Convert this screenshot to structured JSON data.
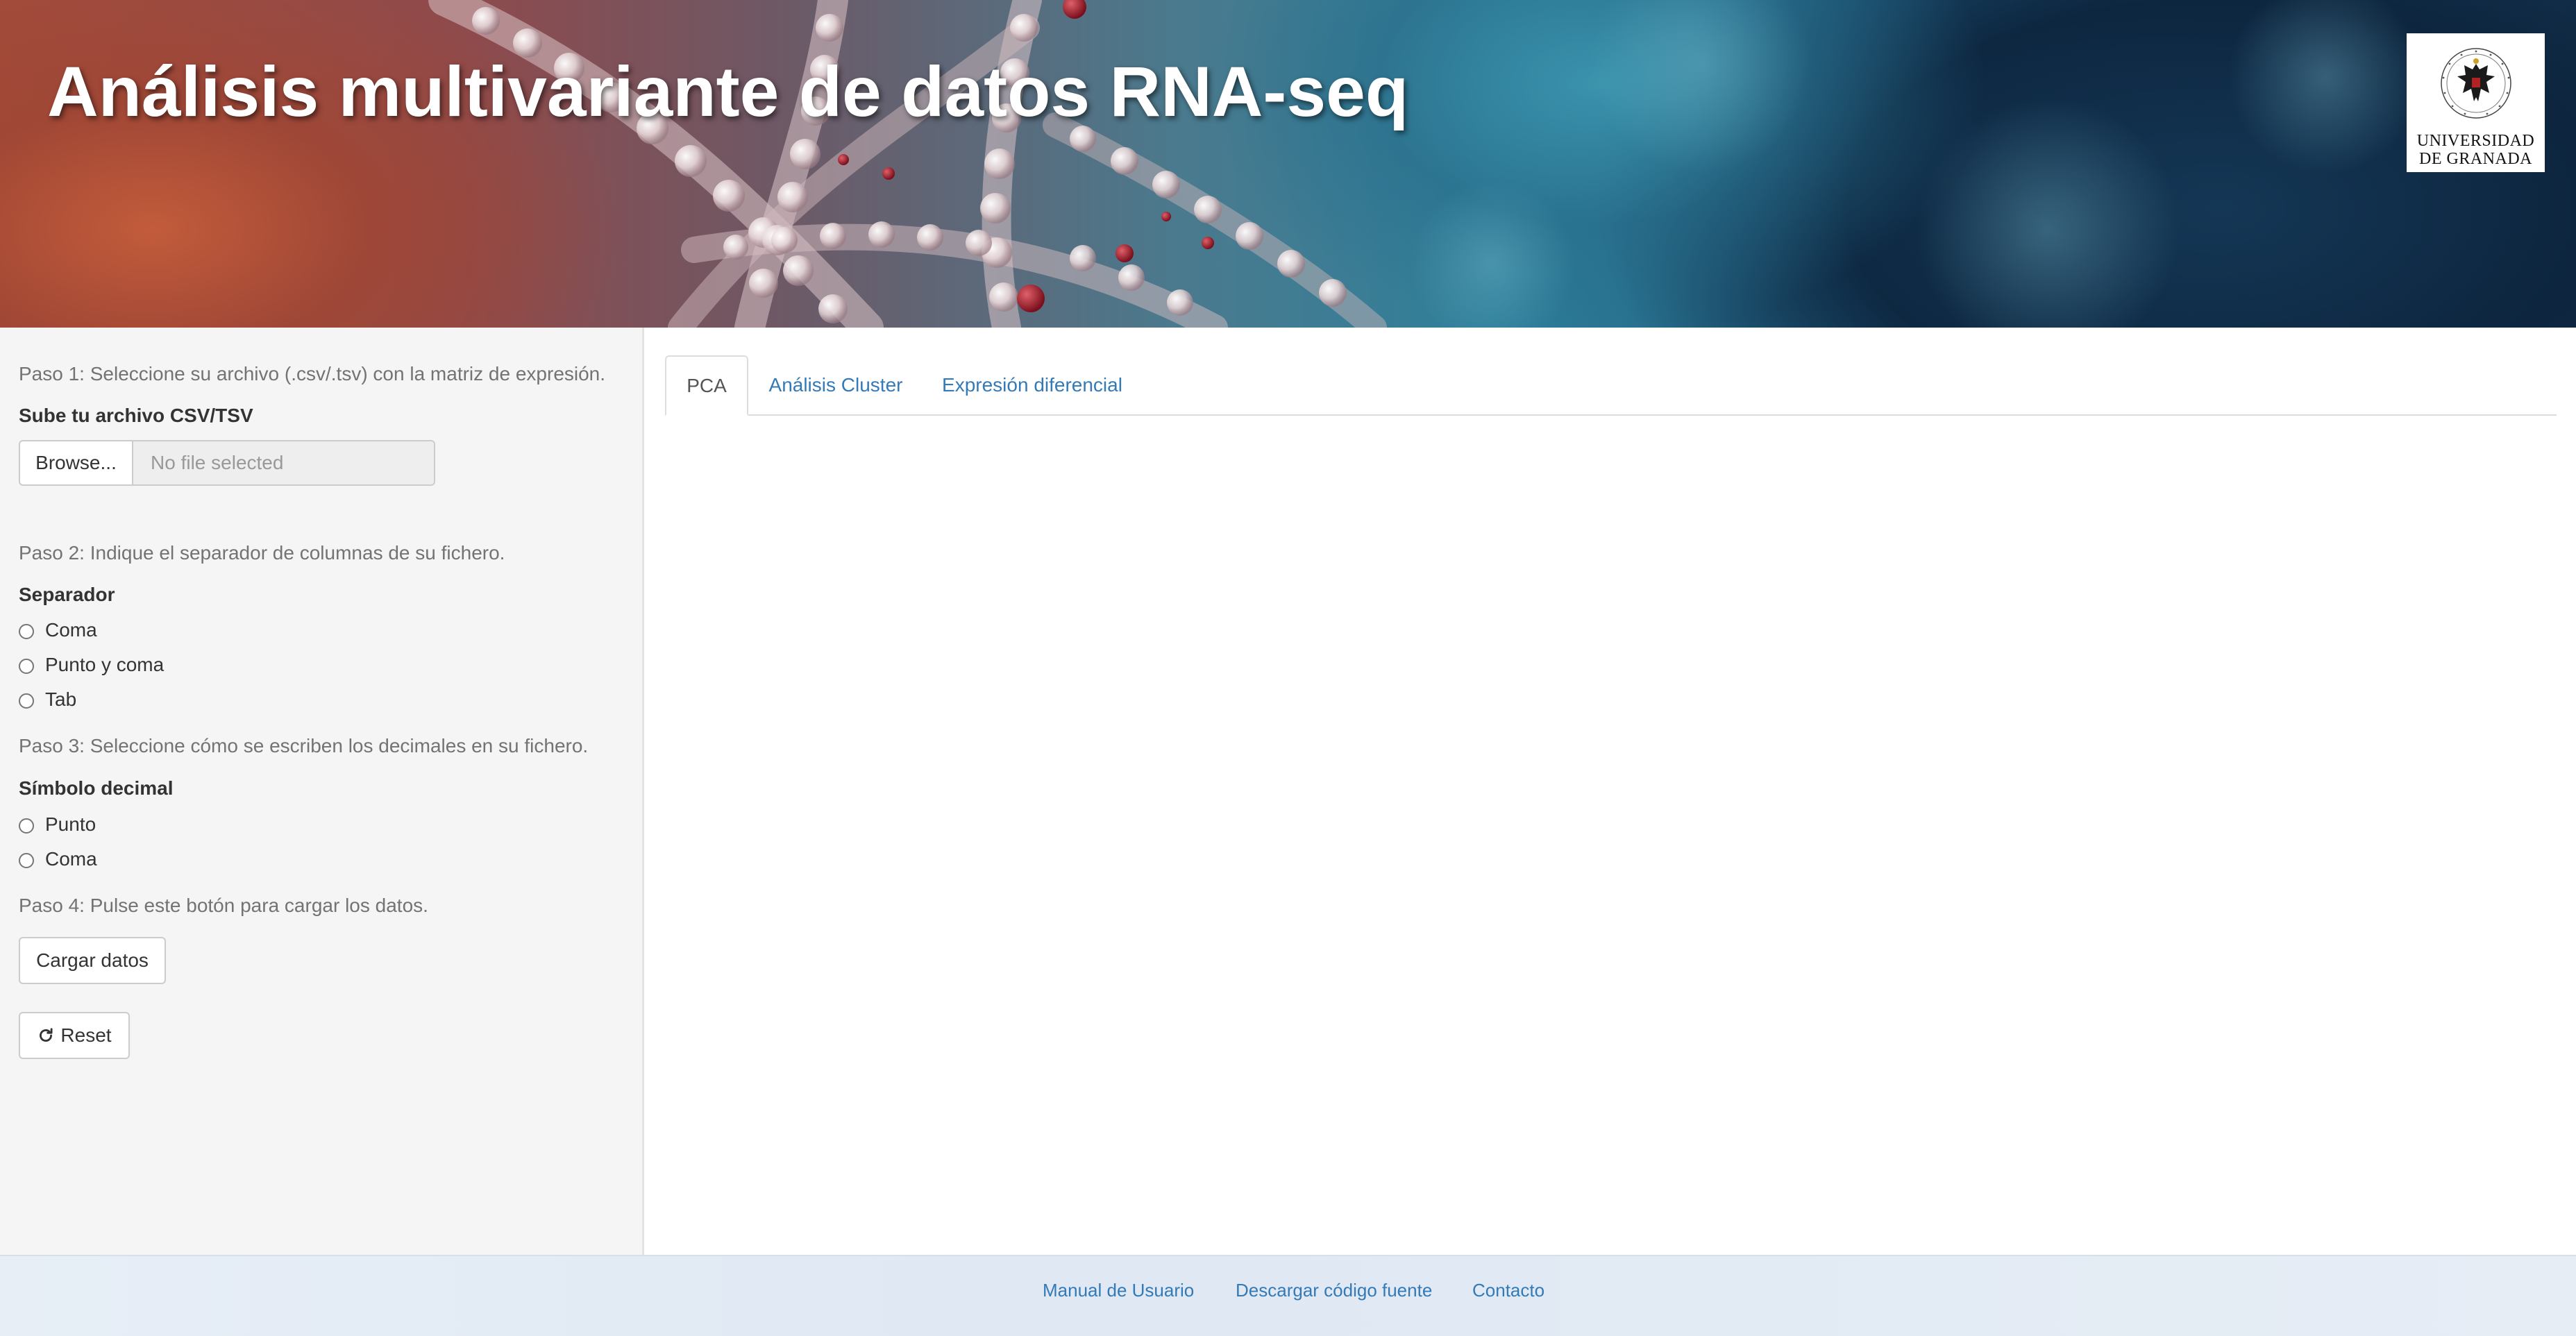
{
  "header": {
    "title": "Análisis multivariante de datos RNA-seq",
    "logo": {
      "icon": "university-crest-icon",
      "line1": "UNIVERSIDAD",
      "line2": "DE GRANADA"
    }
  },
  "sidebar": {
    "step1_text": "Paso 1: Seleccione su archivo (.csv/.tsv) con la matriz de expresión.",
    "file_label": "Sube tu archivo CSV/TSV",
    "browse_label": "Browse...",
    "file_placeholder": "No file selected",
    "step2_text": "Paso 2: Indique el separador de columnas de su fichero.",
    "separator_label": "Separador",
    "separator_options": [
      "Coma",
      "Punto y coma",
      "Tab"
    ],
    "step3_text": "Paso 3: Seleccione cómo se escriben los decimales en su fichero.",
    "decimal_label": "Símbolo decimal",
    "decimal_options": [
      "Punto",
      "Coma"
    ],
    "step4_text": "Paso 4: Pulse este botón para cargar los datos.",
    "load_button": "Cargar datos",
    "reset_button": "Reset",
    "reset_icon": "refresh-icon"
  },
  "main": {
    "tabs": [
      {
        "label": "PCA",
        "active": true
      },
      {
        "label": "Análisis Cluster",
        "active": false
      },
      {
        "label": "Expresión diferencial",
        "active": false
      }
    ]
  },
  "footer": {
    "links": [
      "Manual de Usuario",
      "Descargar código fuente",
      "Contacto"
    ]
  },
  "colors": {
    "link": "#337ab7",
    "sidebar_bg": "#f5f5f5",
    "muted_text": "#737373"
  }
}
